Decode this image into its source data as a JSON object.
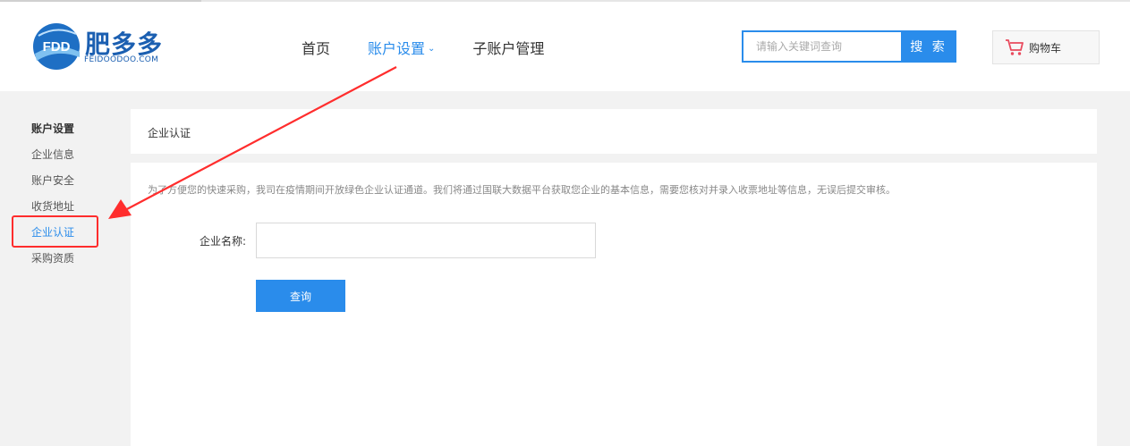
{
  "logo": {
    "badge_text": "FDD",
    "name_cn": "肥多多",
    "name_en": "FEIDOODOO.COM"
  },
  "nav": {
    "items": [
      {
        "label": "首页"
      },
      {
        "label": "账户设置"
      },
      {
        "label": "子账户管理"
      }
    ],
    "active_index": 1
  },
  "search": {
    "placeholder": "请输入关键词查询",
    "value": "",
    "button_label": "搜 索"
  },
  "cart": {
    "label": "购物车",
    "icon": "cart-icon"
  },
  "sidebar": {
    "title": "账户设置",
    "items": [
      {
        "label": "企业信息"
      },
      {
        "label": "账户安全"
      },
      {
        "label": "收货地址"
      },
      {
        "label": "企业认证"
      },
      {
        "label": "采购资质"
      }
    ],
    "active_index": 3
  },
  "page": {
    "section_title": "企业认证",
    "notice": "为了方便您的快速采购，我司在疫情期间开放绿色企业认证通道。我们将通过国联大数据平台获取您企业的基本信息，需要您核对并录入收票地址等信息，无误后提交审核。",
    "company_label": "企业名称:",
    "company_value": "",
    "query_button": "查询"
  },
  "colors": {
    "accent": "#2a8ceb",
    "annotation": "#ff2d2d",
    "brand": "#1b5fb1"
  }
}
